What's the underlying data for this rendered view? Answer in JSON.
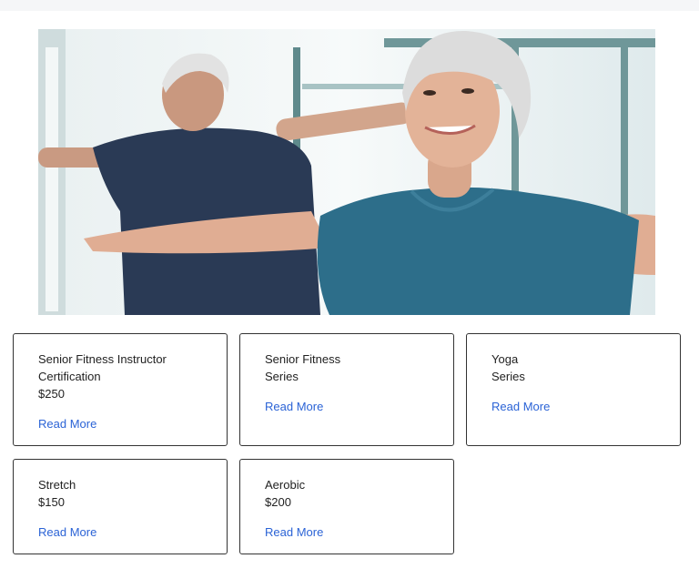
{
  "hero": {
    "image_icon": "senior-fitness-photo"
  },
  "cards": [
    {
      "lines": [
        "Senior Fitness Instructor",
        "Certification",
        "$250"
      ],
      "link": "Read More"
    },
    {
      "lines": [
        "Senior Fitness",
        "Series"
      ],
      "link": "Read More"
    },
    {
      "lines": [
        "Yoga",
        "Series"
      ],
      "link": "Read More"
    },
    {
      "lines": [
        "Stretch",
        "$150"
      ],
      "link": "Read More"
    },
    {
      "lines": [
        "Aerobic",
        "$200"
      ],
      "link": "Read More"
    }
  ],
  "colors": {
    "link": "#2b63d6",
    "border": "#333333",
    "text": "#222222"
  }
}
